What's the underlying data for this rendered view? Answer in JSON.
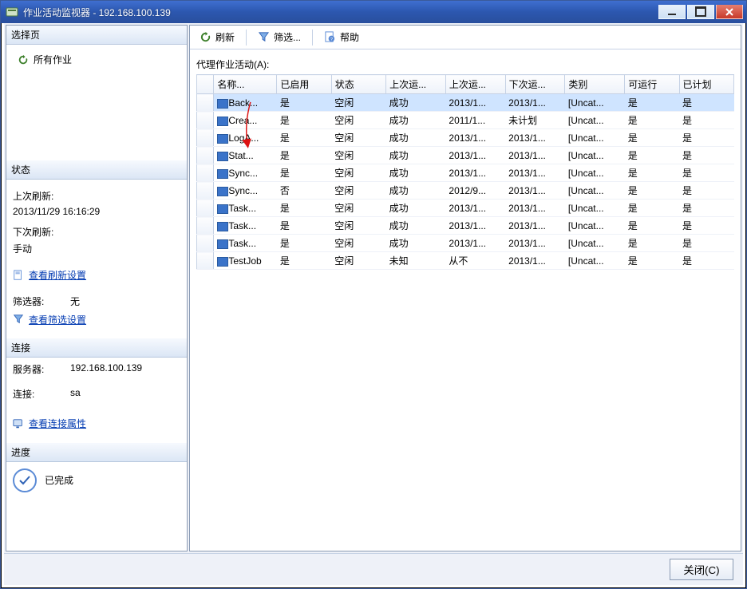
{
  "window": {
    "title": "作业活动监视器 - 192.168.100.139"
  },
  "toolbar": {
    "refresh": "刷新",
    "filter": "筛选...",
    "help": "帮助"
  },
  "sidebar": {
    "select_page": {
      "title": "选择页",
      "all_jobs": "所有作业"
    },
    "status": {
      "title": "状态",
      "last_refresh_label": "上次刷新:",
      "last_refresh_value": "2013/11/29 16:16:29",
      "next_refresh_label": "下次刷新:",
      "next_refresh_value": "手动",
      "view_refresh_settings": "查看刷新设置",
      "filter_label": "筛选器:",
      "filter_value": "无",
      "view_filter_settings": "查看筛选设置"
    },
    "connection": {
      "title": "连接",
      "server_label": "服务器:",
      "server_value": "192.168.100.139",
      "conn_label": "连接:",
      "conn_value": "sa",
      "view_conn_props": "查看连接属性"
    },
    "progress": {
      "title": "进度",
      "status": "已完成"
    }
  },
  "grid": {
    "title": "代理作业活动(A):",
    "columns": [
      "名称...",
      "已启用",
      "状态",
      "上次运...",
      "上次运...",
      "下次运...",
      "类别",
      "可运行",
      "已计划"
    ],
    "rows": [
      {
        "name": "Back...",
        "enabled": "是",
        "state": "空闲",
        "last_result": "成功",
        "last_run": "2013/1...",
        "next_run": "2013/1...",
        "category": "[Uncat...",
        "runnable": "是",
        "scheduled": "是",
        "selected": true
      },
      {
        "name": "Crea...",
        "enabled": "是",
        "state": "空闲",
        "last_result": "成功",
        "last_run": "2011/1...",
        "next_run": "未计划",
        "category": "[Uncat...",
        "runnable": "是",
        "scheduled": "是"
      },
      {
        "name": "LogA...",
        "enabled": "是",
        "state": "空闲",
        "last_result": "成功",
        "last_run": "2013/1...",
        "next_run": "2013/1...",
        "category": "[Uncat...",
        "runnable": "是",
        "scheduled": "是"
      },
      {
        "name": "Stat...",
        "enabled": "是",
        "state": "空闲",
        "last_result": "成功",
        "last_run": "2013/1...",
        "next_run": "2013/1...",
        "category": "[Uncat...",
        "runnable": "是",
        "scheduled": "是"
      },
      {
        "name": "Sync...",
        "enabled": "是",
        "state": "空闲",
        "last_result": "成功",
        "last_run": "2013/1...",
        "next_run": "2013/1...",
        "category": "[Uncat...",
        "runnable": "是",
        "scheduled": "是"
      },
      {
        "name": "Sync...",
        "enabled": "否",
        "state": "空闲",
        "last_result": "成功",
        "last_run": "2012/9...",
        "next_run": "2013/1...",
        "category": "[Uncat...",
        "runnable": "是",
        "scheduled": "是"
      },
      {
        "name": "Task...",
        "enabled": "是",
        "state": "空闲",
        "last_result": "成功",
        "last_run": "2013/1...",
        "next_run": "2013/1...",
        "category": "[Uncat...",
        "runnable": "是",
        "scheduled": "是"
      },
      {
        "name": "Task...",
        "enabled": "是",
        "state": "空闲",
        "last_result": "成功",
        "last_run": "2013/1...",
        "next_run": "2013/1...",
        "category": "[Uncat...",
        "runnable": "是",
        "scheduled": "是"
      },
      {
        "name": "Task...",
        "enabled": "是",
        "state": "空闲",
        "last_result": "成功",
        "last_run": "2013/1...",
        "next_run": "2013/1...",
        "category": "[Uncat...",
        "runnable": "是",
        "scheduled": "是"
      },
      {
        "name": "TestJob",
        "enabled": "是",
        "state": "空闲",
        "last_result": "未知",
        "last_run": "从不",
        "next_run": "2013/1...",
        "category": "[Uncat...",
        "runnable": "是",
        "scheduled": "是"
      }
    ]
  },
  "footer": {
    "close": "关闭(C)"
  }
}
